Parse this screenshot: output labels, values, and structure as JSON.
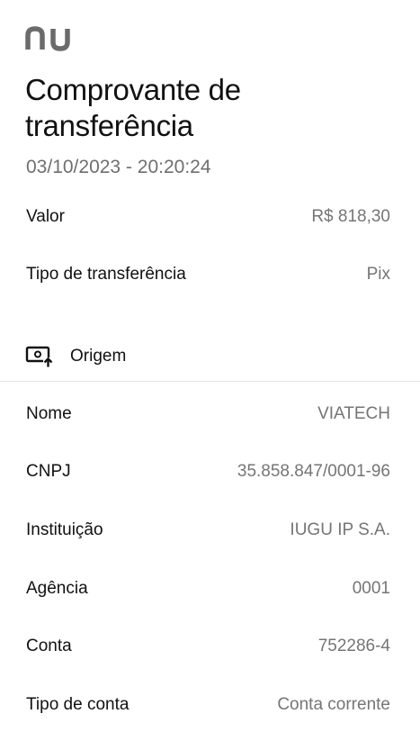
{
  "brand": {
    "logo_text": "nu",
    "logo_color": "#6b6b6b"
  },
  "header": {
    "title_line1": "Comprovante de",
    "title_line2": "transferência",
    "datetime": "03/10/2023 - 20:20:24"
  },
  "summary": [
    {
      "label": "Valor",
      "value": "R$ 818,30"
    },
    {
      "label": "Tipo de transferência",
      "value": "Pix"
    }
  ],
  "origin": {
    "section_label": "Origem",
    "section_icon": "account-transfer-out-icon",
    "fields": [
      {
        "label": "Nome",
        "value": "VIATECH"
      },
      {
        "label": "CNPJ",
        "value": "35.858.847/0001-96"
      },
      {
        "label": "Instituição",
        "value": "IUGU IP S.A."
      },
      {
        "label": "Agência",
        "value": "0001"
      },
      {
        "label": "Conta",
        "value": "752286-4"
      },
      {
        "label": "Tipo de conta",
        "value": "Conta corrente"
      }
    ]
  },
  "colors": {
    "text_primary": "#111111",
    "text_secondary": "#757575",
    "divider": "#e3e3e3"
  }
}
